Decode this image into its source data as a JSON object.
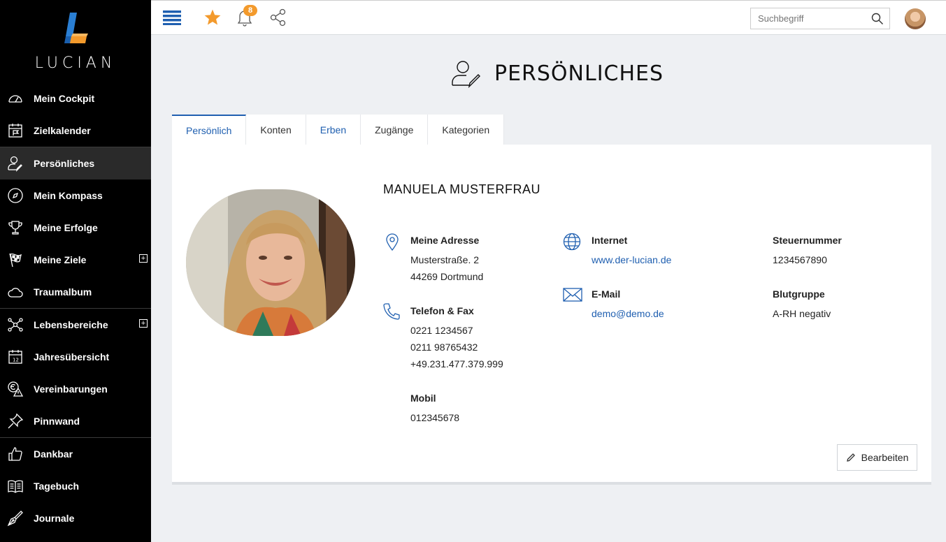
{
  "app": {
    "brand": "LUCIAN"
  },
  "sidebar": {
    "groups": [
      [
        {
          "label": "Mein Cockpit",
          "icon": "gauge-icon"
        },
        {
          "label": "Zielkalender",
          "icon": "calendar-flag-icon"
        }
      ],
      [
        {
          "label": "Persönliches",
          "icon": "user-edit-icon",
          "active": true
        },
        {
          "label": "Mein Kompass",
          "icon": "compass-icon"
        },
        {
          "label": "Meine Erfolge",
          "icon": "trophy-icon"
        },
        {
          "label": "Meine Ziele",
          "icon": "checkered-flag-icon",
          "expandable": true
        },
        {
          "label": "Traumalbum",
          "icon": "cloud-icon"
        }
      ],
      [
        {
          "label": "Lebensbereiche",
          "icon": "network-icon",
          "expandable": true
        },
        {
          "label": "Jahresübersicht",
          "icon": "calendar-12-icon"
        },
        {
          "label": "Vereinbarungen",
          "icon": "euro-warning-icon"
        },
        {
          "label": "Pinnwand",
          "icon": "pin-icon"
        }
      ],
      [
        {
          "label": "Dankbar",
          "icon": "thumbs-up-icon"
        },
        {
          "label": "Tagebuch",
          "icon": "open-book-icon"
        },
        {
          "label": "Journale",
          "icon": "fountain-pen-icon"
        }
      ]
    ],
    "expand_symbol": "+"
  },
  "topbar": {
    "notifications_count": "8",
    "search_placeholder": "Suchbegriff",
    "accent_color": "#1f5fb0",
    "star_color": "#f39a2c"
  },
  "page": {
    "title": "PERSÖNLICHES"
  },
  "tabs": [
    {
      "label": "Persönlich",
      "active": true
    },
    {
      "label": "Konten"
    },
    {
      "label": "Erben",
      "link": true
    },
    {
      "label": "Zugänge"
    },
    {
      "label": "Kategorien"
    }
  ],
  "profile": {
    "name": "MANUELA MUSTERFRAU",
    "address": {
      "title": "Meine Adresse",
      "lines": [
        "Musterstraße. 2",
        "44269 Dortmund"
      ]
    },
    "phone": {
      "title": "Telefon & Fax",
      "lines": [
        "0221 1234567",
        "0211 98765432",
        "+49.231.477.379.999"
      ]
    },
    "mobile": {
      "title": "Mobil",
      "lines": [
        "012345678"
      ]
    },
    "internet": {
      "title": "Internet",
      "value": "www.der-lucian.de"
    },
    "email": {
      "title": "E-Mail",
      "value": "demo@demo.de"
    },
    "tax": {
      "title": "Steuernummer",
      "value": "1234567890"
    },
    "blood": {
      "title": "Blutgruppe",
      "value": "A-RH negativ"
    }
  },
  "actions": {
    "edit_label": "Bearbeiten"
  }
}
